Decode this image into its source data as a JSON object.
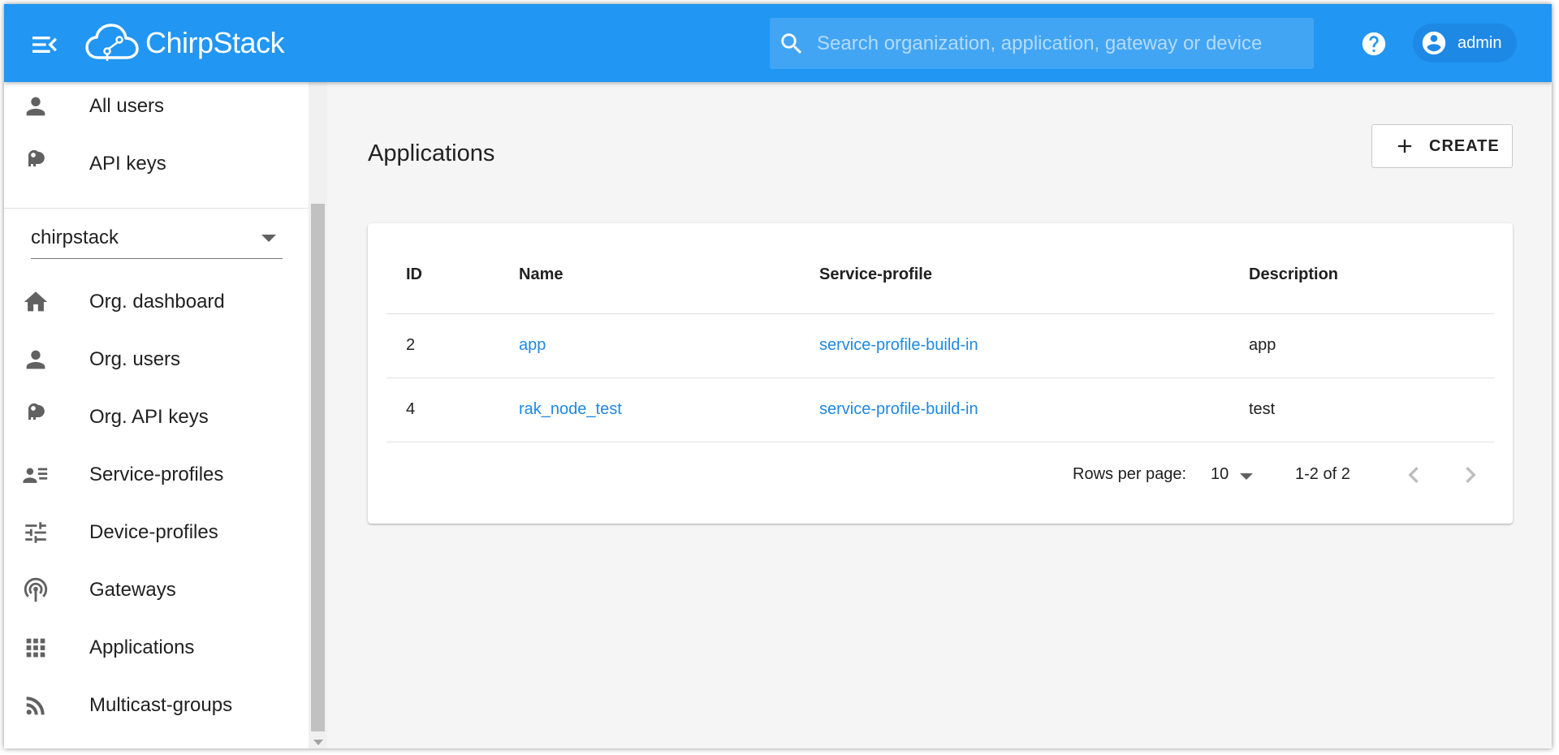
{
  "header": {
    "logo_text": "ChirpStack",
    "search_placeholder": "Search organization, application, gateway or device",
    "user_label": "admin"
  },
  "sidebar": {
    "global_items": [
      {
        "label": "All users",
        "icon": "person-icon"
      },
      {
        "label": "API keys",
        "icon": "key-icon"
      }
    ],
    "organization_select": "chirpstack",
    "org_items": [
      {
        "label": "Org. dashboard",
        "icon": "home-icon"
      },
      {
        "label": "Org. users",
        "icon": "person-icon"
      },
      {
        "label": "Org. API keys",
        "icon": "key-icon"
      },
      {
        "label": "Service-profiles",
        "icon": "contact-list-icon"
      },
      {
        "label": "Device-profiles",
        "icon": "tune-icon"
      },
      {
        "label": "Gateways",
        "icon": "gateway-icon"
      },
      {
        "label": "Applications",
        "icon": "apps-grid-icon"
      },
      {
        "label": "Multicast-groups",
        "icon": "rss-feed-icon"
      }
    ]
  },
  "main": {
    "title": "Applications",
    "create_label": "CREATE",
    "table": {
      "columns": [
        "ID",
        "Name",
        "Service-profile",
        "Description"
      ],
      "rows": [
        {
          "id": "2",
          "name": "app",
          "service_profile": "service-profile-build-in",
          "description": "app"
        },
        {
          "id": "4",
          "name": "rak_node_test",
          "service_profile": "service-profile-build-in",
          "description": "test"
        }
      ]
    },
    "pagination": {
      "rows_per_page_label": "Rows per page:",
      "rows_per_page": "10",
      "range": "1-2 of 2"
    }
  },
  "colors": {
    "appbar": "#2196f3",
    "link": "#1e88e5",
    "background": "#f5f5f5"
  }
}
